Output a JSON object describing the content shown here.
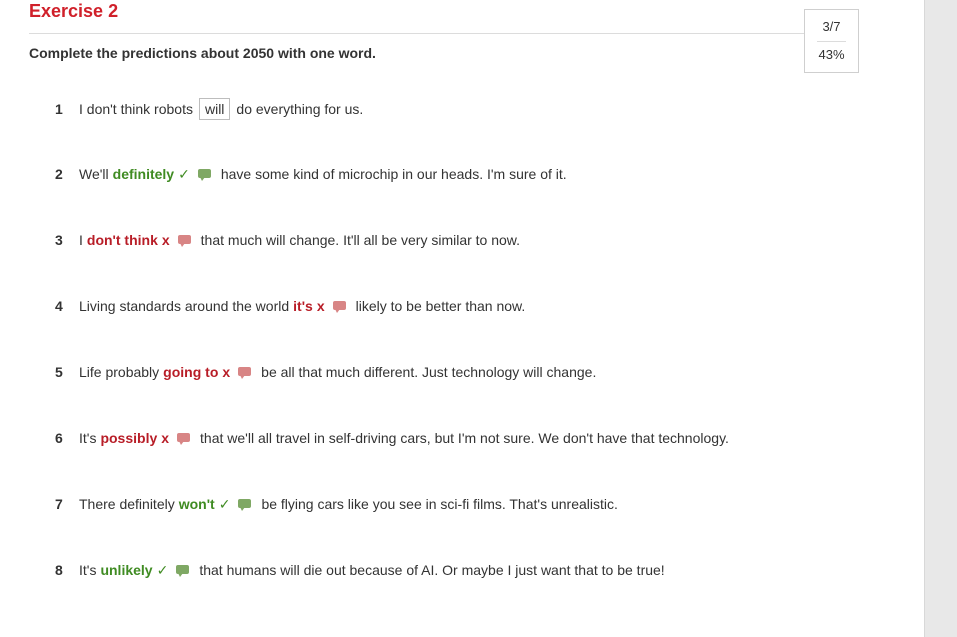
{
  "header": {
    "title": "Exercise 2",
    "instructions": "Complete the predictions about 2050 with one word."
  },
  "score": {
    "fraction": "3/7",
    "percent": "43%"
  },
  "items": [
    {
      "number": "1",
      "before": "I don't think robots",
      "answer": "will",
      "status": "example",
      "after": "do everything for us."
    },
    {
      "number": "2",
      "before": "We'll",
      "answer": "definitely",
      "status": "correct",
      "mark": "✓",
      "after": "have some kind of microchip in our heads. I'm sure of it."
    },
    {
      "number": "3",
      "before": "I",
      "answer": "don't think",
      "status": "wrong",
      "mark": "x",
      "after": "that much will change. It'll all be very similar to now."
    },
    {
      "number": "4",
      "before": "Living standards around the world",
      "answer": "it's",
      "status": "wrong",
      "mark": "x",
      "after": "likely to be better than now."
    },
    {
      "number": "5",
      "before": "Life probably",
      "answer": "going to",
      "status": "wrong",
      "mark": "x",
      "after": "be all that much different. Just technology will change."
    },
    {
      "number": "6",
      "before": "It's",
      "answer": "possibly",
      "status": "wrong",
      "mark": "x",
      "after": "that we'll all travel in self-driving cars, but I'm not sure. We don't have that technology."
    },
    {
      "number": "7",
      "before": "There definitely",
      "answer": "won't",
      "status": "correct",
      "mark": "✓",
      "after": "be flying cars like you see in sci-fi films. That's unrealistic."
    },
    {
      "number": "8",
      "before": "It's",
      "answer": "unlikely",
      "status": "correct",
      "mark": "✓",
      "after": "that humans will die out because of AI. Or maybe I just want that to be true!"
    }
  ],
  "colors": {
    "title": "#d0202a",
    "correct": "#3f8b22",
    "wrong": "#b81d27"
  }
}
